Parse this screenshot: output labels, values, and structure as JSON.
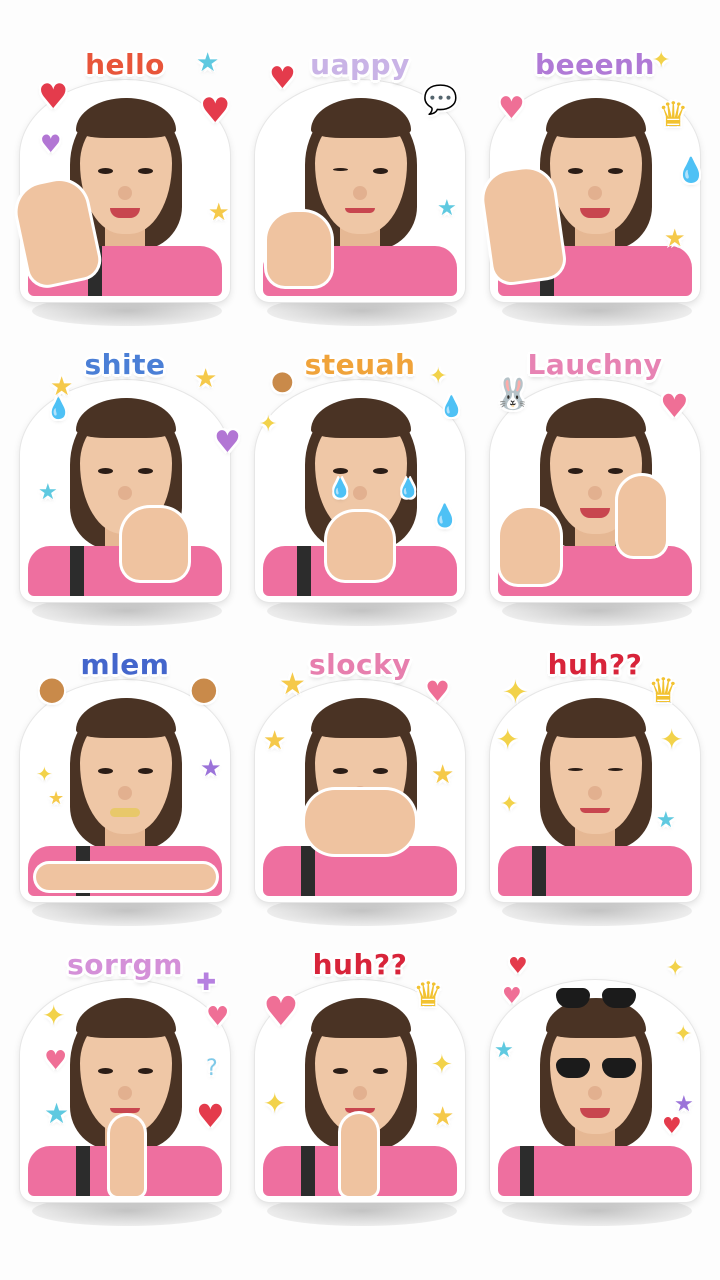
{
  "stickers": [
    {
      "label": "hello",
      "label_color": "#e8553a"
    },
    {
      "label": "uappy",
      "label_color": "#c9b3e6"
    },
    {
      "label": "beeenh",
      "label_color": "#b07ad6"
    },
    {
      "label": "shite",
      "label_color": "#4b7fd6"
    },
    {
      "label": "steuah",
      "label_color": "#f0a33a"
    },
    {
      "label": "Lauchny",
      "label_color": "#e783b3"
    },
    {
      "label": "mlem",
      "label_color": "#4466cc"
    },
    {
      "label": "slocky",
      "label_color": "#e77fae"
    },
    {
      "label": "huh??",
      "label_color": "#d8243a"
    },
    {
      "label": "sorrgm",
      "label_color": "#d490d8"
    },
    {
      "label": "huh??",
      "label_color": "#d8243a"
    },
    {
      "label": "",
      "label_color": "#d8243a"
    }
  ],
  "decorations": {
    "heart-icon": {
      "glyph": "♥",
      "color": "#e43b4c"
    },
    "pink-heart-icon": {
      "glyph": "♥",
      "color": "#ef6f96"
    },
    "purple-heart-icon": {
      "glyph": "♥",
      "color": "#b276d4"
    },
    "star-icon": {
      "glyph": "★",
      "color": "#f5c94a"
    },
    "blue-star-icon": {
      "glyph": "★",
      "color": "#5fc9e0"
    },
    "purple-star-icon": {
      "glyph": "★",
      "color": "#9b73d9"
    },
    "sparkle-icon": {
      "glyph": "✦",
      "color": "#f2d24a"
    },
    "crown-icon": {
      "glyph": "♛",
      "color": "#f2c230"
    },
    "droplet-icon": {
      "glyph": "💧",
      "color": "#69c5e8"
    },
    "speech-bubble-icon": {
      "glyph": "💬",
      "color": "#9dcde6"
    },
    "bunny-icon": {
      "glyph": "🐰",
      "color": "#ef8aa8"
    },
    "cookie-icon": {
      "glyph": "●",
      "color": "#c98a4a"
    },
    "question-icon": {
      "glyph": "?",
      "color": "#7fc9e8"
    },
    "plus-icon": {
      "glyph": "✚",
      "color": "#b680e0"
    }
  }
}
